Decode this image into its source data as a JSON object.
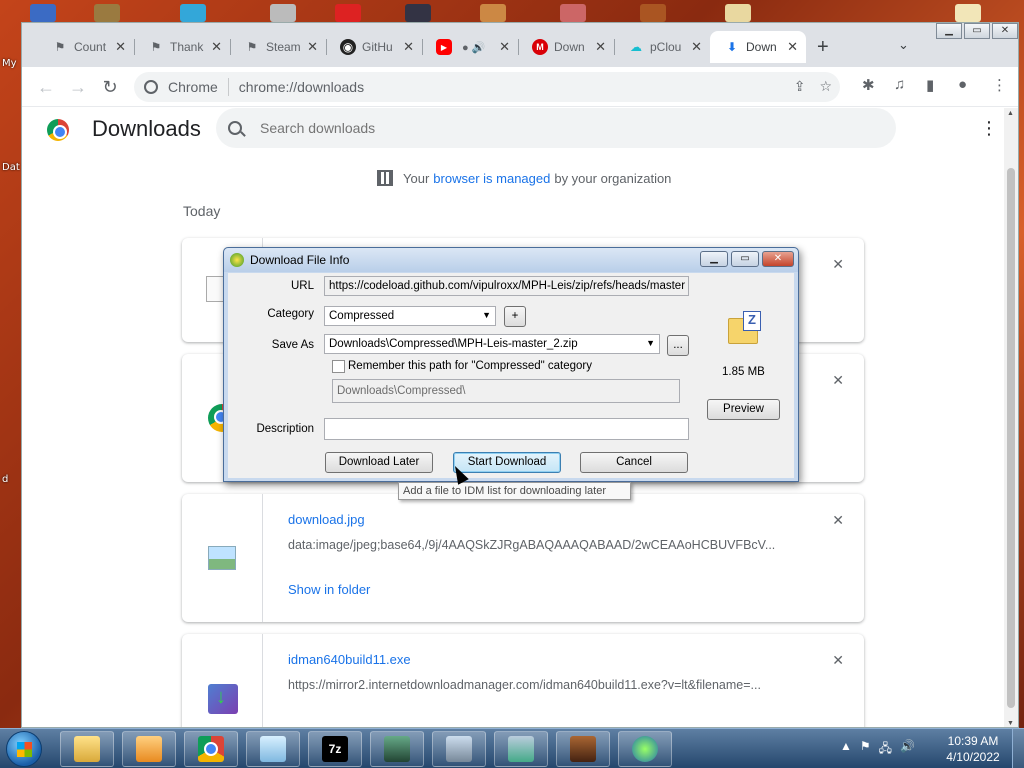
{
  "desktop": {
    "left_labels": [
      "My",
      "Dat",
      "d"
    ]
  },
  "tabs": [
    {
      "title": "Count",
      "icon": "cs-icon"
    },
    {
      "title": "Thank",
      "icon": "cs-icon"
    },
    {
      "title": "Steam",
      "icon": "cs-icon"
    },
    {
      "title": "GitHu",
      "icon": "github-icon"
    },
    {
      "title": "",
      "icon": "youtube-icon"
    },
    {
      "title": "Down",
      "icon": "mega-icon"
    },
    {
      "title": "pClou",
      "icon": "pcloud-icon"
    },
    {
      "title": "Down",
      "icon": "download-icon",
      "active": true
    }
  ],
  "toolbar": {
    "site_chip": "Chrome",
    "url": "chrome://downloads"
  },
  "downloads_page": {
    "title": "Downloads",
    "search_placeholder": "Search downloads",
    "managed_prefix": "Your",
    "managed_link": "browser is managed",
    "managed_suffix": "by your organization",
    "section": "Today",
    "items": [
      {
        "name": "",
        "url": "",
        "show": ""
      },
      {
        "name": "",
        "url": "",
        "show": ""
      },
      {
        "name": "download.jpg",
        "url": "data:image/jpeg;base64,/9j/4AAQSkZJRgABAQAAAQABAAD/2wCEAAoHCBUVFBcV...",
        "show": "Show in folder"
      },
      {
        "name": "idman640build11.exe",
        "url": "https://mirror2.internetdownloadmanager.com/idman640build11.exe?v=lt&filename=...",
        "show": ""
      }
    ]
  },
  "dialog": {
    "title": "Download File Info",
    "url_label": "URL",
    "url_value": "https://codeload.github.com/vipulroxx/MPH-Leis/zip/refs/heads/master",
    "category_label": "Category",
    "category_value": "Compressed",
    "add_label": "+",
    "saveas_label": "Save As",
    "saveas_value": "Downloads\\Compressed\\MPH-Leis-master_2.zip",
    "browse_label": "...",
    "remember_label": "Remember this path for \"Compressed\" category",
    "remember_path": "Downloads\\Compressed\\",
    "description_label": "Description",
    "description_value": "",
    "size": "1.85  MB",
    "preview_label": "Preview",
    "download_later_label": "Download Later",
    "start_download_label": "Start Download",
    "cancel_label": "Cancel"
  },
  "tooltip": "Add a file to IDM list for downloading later",
  "taskbar": {
    "time": "10:39 AM",
    "date": "4/10/2022"
  },
  "colors": {
    "link_blue": "#1a73e8",
    "dialog_frame": "#c8d9ee",
    "taskbar": "#25476d"
  }
}
